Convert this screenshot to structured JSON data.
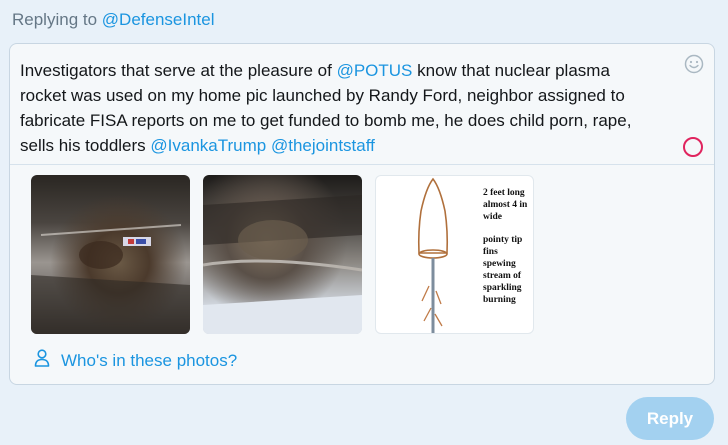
{
  "replying": {
    "prefix": "Replying to",
    "handle": "@DefenseIntel"
  },
  "composer": {
    "text_segments": [
      {
        "text": "Investigators that serve at the pleasure of ",
        "mention": false
      },
      {
        "text": "@POTUS",
        "mention": true
      },
      {
        "text": " know that nuclear plasma rocket was used on my home pic launched by Randy Ford, neighbor assigned to fabricate FISA reports on me to get funded to bomb me, he does child porn, rape, sells his toddlers ",
        "mention": false
      },
      {
        "text": "@IvankaTrump",
        "mention": true
      },
      {
        "text": " ",
        "mention": false
      },
      {
        "text": "@thejointstaff",
        "mention": true
      }
    ],
    "emoji_icon": "smiley-icon",
    "counter_color": "#e0245e",
    "tag_people_label": "Who's in these photos?"
  },
  "media": {
    "drawing_notes": [
      "2 feet long",
      "almost 4 in",
      "wide",
      "pointy tip",
      "fins",
      "spewing",
      "stream of",
      "sparkling",
      "burning"
    ]
  },
  "reply_button": {
    "label": "Reply",
    "color": "#a3d1f0"
  }
}
